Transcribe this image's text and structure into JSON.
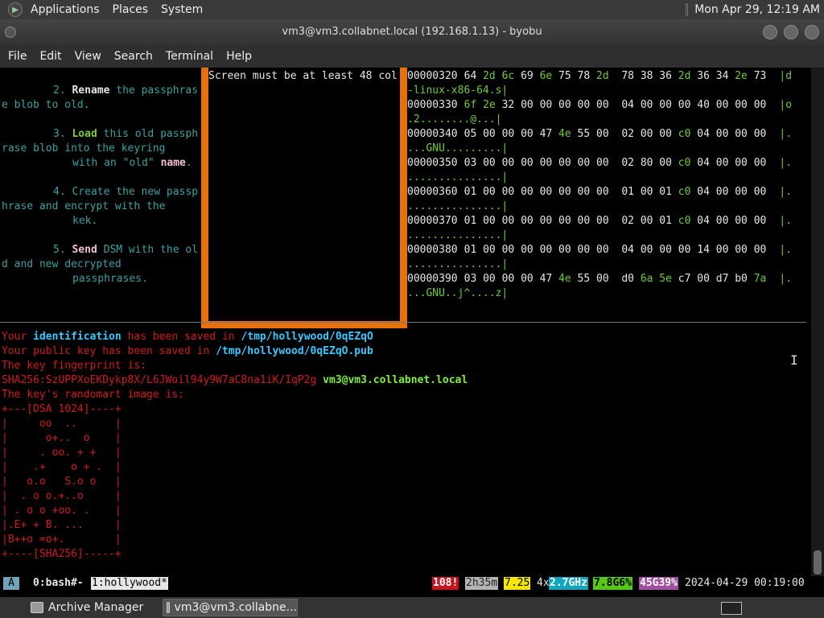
{
  "panel": {
    "applications": "Applications",
    "places": "Places",
    "system": "System",
    "clock": "Mon Apr 29, 12:19 AM"
  },
  "window": {
    "title": "vm3@vm3.collabnet.local (192.168.1.13) - byobu"
  },
  "menu": [
    "File",
    "Edit",
    "View",
    "Search",
    "Terminal",
    "Help"
  ],
  "left_pane": [
    {
      "num": "2.",
      "bold": "Rename",
      "text": " the passphras",
      "cont": "e blob to old."
    },
    {
      "num": "3.",
      "bold": "Load",
      "text": " this old passph",
      "cont": "rase blob into the keyring",
      "cont2a": "with an \"old\" ",
      "cont2b": "name",
      "cont2c": "."
    },
    {
      "num": "4.",
      "text": "Create the new passp",
      "cont": "hrase and encrypt with the",
      "cont2a": "kek."
    },
    {
      "num": "5.",
      "bold": "Send",
      "text": " DSM with the ol",
      "cont": "d and new decrypted",
      "cont2a": "passphrases."
    }
  ],
  "popup_message": "Screen must be at least 48 col",
  "hexdump": [
    {
      "addr": "00000320",
      "bytes": "64 2d 6c 69 6e 75 78 2d  78 38 36 2d 36 34 2e 73",
      "ascii": "|d",
      "ascii2": "-linux-x86-64.s|"
    },
    {
      "addr": "00000330",
      "bytes": "6f 2e 32 00 00 00 00 00  04 00 00 00 40 00 00 00",
      "ascii": "|o",
      "ascii2": ".2........@...|"
    },
    {
      "addr": "00000340",
      "bytes": "05 00 00 00 47 4e 55 00  02 00 00 c0 04 00 00 00",
      "ascii": "|.",
      "ascii2": "...GNU.........|"
    },
    {
      "addr": "00000350",
      "bytes": "03 00 00 00 00 00 00 00  02 80 00 c0 04 00 00 00",
      "ascii": "|.",
      "ascii2": "...............|"
    },
    {
      "addr": "00000360",
      "bytes": "01 00 00 00 00 00 00 00  01 00 01 c0 04 00 00 00",
      "ascii": "|.",
      "ascii2": "...............|"
    },
    {
      "addr": "00000370",
      "bytes": "01 00 00 00 00 00 00 00  02 00 01 c0 04 00 00 00",
      "ascii": "|.",
      "ascii2": "...............|"
    },
    {
      "addr": "00000380",
      "bytes": "01 00 00 00 00 00 00 00  04 00 00 00 14 00 00 00",
      "ascii": "|.",
      "ascii2": "...............|"
    },
    {
      "addr": "00000390",
      "bytes": "03 00 00 00 47 4e 55 00  d0 6a 5e c7 00 d7 b0 7a",
      "ascii": "|.",
      "ascii2": "...GNU..j^....z|"
    }
  ],
  "keygen": {
    "l1a": "Your ",
    "l1b": "identification",
    "l1c": " has been saved in ",
    "l1d": "/tmp/hollywood/0qEZqO",
    "l2a": "Your public key has been saved in ",
    "l2b": "/tmp/hollywood/0qEZqO.pub",
    "l3": "The key fingerprint is:",
    "l4a": "SHA256:SzUPPXoEKDykp8X/L6JWoil94y9W7aC8na1iK/IqP2g",
    "l4b": " vm3@vm3.collabnet.local",
    "l5": "The key's randomart image is:",
    "art": [
      "+---[DSA 1024]----+",
      "|     oo  ..      |",
      "|      o+..  o    |",
      "|     . oo. + +   |",
      "|    .+    o + .  |",
      "|   o.o   S.o o   |",
      "|  . o o.+..o     |",
      "| . o o +oo. .    |",
      "|.E+ + B. ...     |",
      "|B++o =o+.        |",
      "+----[SHA256]-----+"
    ]
  },
  "status": {
    "a_label": "A",
    "win0": "0:bash#-",
    "win1": "1:hollywood*",
    "updates": "108!",
    "uptime": "2h35m",
    "load": "7.25",
    "cpu_count": "4x",
    "cpu_freq": "2.7GHz",
    "mem": "7.8G6%",
    "disk": "45G39%",
    "datetime": "2024-04-29 00:19:00",
    "colors": {
      "updates_bg": "#c8141e",
      "uptime_bg": "#b4b4b4",
      "load_bg": "#f5e600",
      "cpu_bg": "#12a5c0",
      "mem_bg": "#55c814",
      "disk_bg": "#a050a0"
    }
  },
  "taskbar": {
    "archive": "Archive Manager",
    "terminal": "vm3@vm3.collabne..."
  }
}
